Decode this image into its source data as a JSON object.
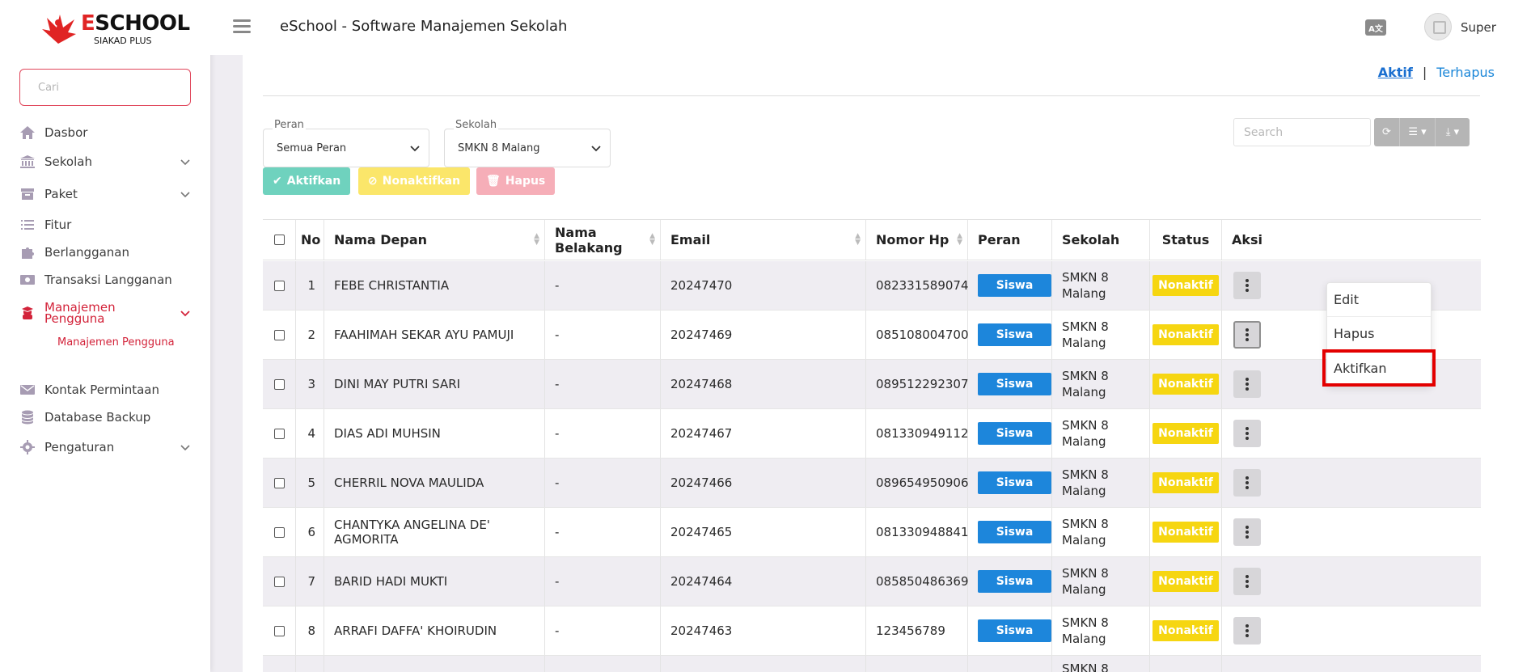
{
  "brand": {
    "title_e": "E",
    "title_rest": "SCHOOL",
    "subtitle": "SIAKAD PLUS"
  },
  "sidebar": {
    "search_placeholder": "Cari",
    "items": [
      {
        "label": "Dasbor",
        "icon": "home-icon"
      },
      {
        "label": "Sekolah",
        "icon": "school-icon"
      },
      {
        "label": "Paket",
        "icon": "package-icon"
      },
      {
        "label": "Fitur",
        "icon": "list-icon"
      },
      {
        "label": "Berlangganan",
        "icon": "puzzle-icon"
      },
      {
        "label": "Transaksi Langganan",
        "icon": "money-icon"
      },
      {
        "label": "Manajemen Pengguna",
        "icon": "users-icon"
      },
      {
        "label": "Kontak Permintaan",
        "icon": "mail-icon"
      },
      {
        "label": "Database Backup",
        "icon": "database-icon"
      },
      {
        "label": "Pengaturan",
        "icon": "gear-icon"
      }
    ],
    "sub_item": "Manajemen Pengguna"
  },
  "topbar": {
    "title": "eSchool - Software Manajemen Sekolah",
    "user": "Super"
  },
  "tabs": {
    "active": "Aktif",
    "deleted": "Terhapus"
  },
  "filters": {
    "role": {
      "label": "Peran",
      "value": "Semua Peran"
    },
    "school": {
      "label": "Sekolah",
      "value": "SMKN 8 Malang"
    }
  },
  "table_search_placeholder": "Search",
  "actions": {
    "activate": "Aktifkan",
    "deactivate": "Nonaktifkan",
    "delete": "Hapus"
  },
  "colors": {
    "accent": "#d3233a",
    "role_badge": "#1d86db",
    "status_badge": "#f6d611",
    "activate": "#6fd2be",
    "deactivate": "#fbe66a",
    "delete": "#f6aeb8"
  },
  "table": {
    "headers": [
      "No",
      "Nama Depan",
      "Nama Belakang",
      "Email",
      "Nomor Hp",
      "Peran",
      "Sekolah",
      "Status",
      "Aksi"
    ],
    "rows": [
      {
        "no": "1",
        "first": "FEBE CHRISTANTIA",
        "last": "-",
        "email": "20247470",
        "phone": "082331589074",
        "role": "Siswa",
        "school1": "SMKN 8",
        "school2": "Malang",
        "status": "Nonaktif"
      },
      {
        "no": "2",
        "first": "FAAHIMAH SEKAR AYU PAMUJI",
        "last": "-",
        "email": "20247469",
        "phone": "085108004700",
        "role": "Siswa",
        "school1": "SMKN 8",
        "school2": "Malang",
        "status": "Nonaktif"
      },
      {
        "no": "3",
        "first": "DINI MAY PUTRI SARI",
        "last": "-",
        "email": "20247468",
        "phone": "089512292307",
        "role": "Siswa",
        "school1": "SMKN 8",
        "school2": "Malang",
        "status": "Nonaktif"
      },
      {
        "no": "4",
        "first": "DIAS ADI MUHSIN",
        "last": "-",
        "email": "20247467",
        "phone": "081330949112",
        "role": "Siswa",
        "school1": "SMKN 8",
        "school2": "Malang",
        "status": "Nonaktif"
      },
      {
        "no": "5",
        "first": "CHERRIL NOVA MAULIDA",
        "last": "-",
        "email": "20247466",
        "phone": "089654950906",
        "role": "Siswa",
        "school1": "SMKN 8",
        "school2": "Malang",
        "status": "Nonaktif"
      },
      {
        "no": "6",
        "first": "CHANTYKA ANGELINA DE' AGMORITA",
        "last": "-",
        "email": "20247465",
        "phone": "081330948841",
        "role": "Siswa",
        "school1": "SMKN 8",
        "school2": "Malang",
        "status": "Nonaktif"
      },
      {
        "no": "7",
        "first": "BARID HADI MUKTI",
        "last": "-",
        "email": "20247464",
        "phone": "085850486369",
        "role": "Siswa",
        "school1": "SMKN 8",
        "school2": "Malang",
        "status": "Nonaktif"
      },
      {
        "no": "8",
        "first": "ARRAFI DAFFA' KHOIRUDIN",
        "last": "-",
        "email": "20247463",
        "phone": "123456789",
        "role": "Siswa",
        "school1": "SMKN 8",
        "school2": "Malang",
        "status": "Nonaktif"
      },
      {
        "no": "",
        "first": "",
        "last": "",
        "email": "",
        "phone": "",
        "role": "",
        "school1": "SMKN 8",
        "school2": "",
        "status": ""
      }
    ]
  },
  "row_menu": [
    "Edit",
    "Hapus",
    "Aktifkan"
  ]
}
